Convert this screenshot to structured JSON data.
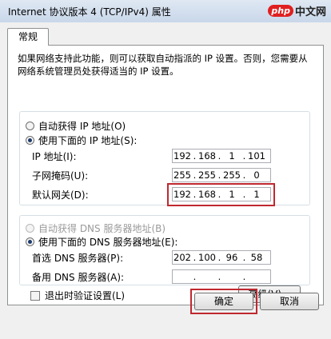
{
  "window": {
    "title": "Internet 协议版本 4 (TCP/IPv4) 属性",
    "watermark_logo": "php",
    "watermark_text": "中文网"
  },
  "tab": {
    "label": "常规"
  },
  "description": "如果网络支持此功能，则可以获取自动指派的 IP 设置。否则，您需要从网络系统管理员处获得适当的 IP 设置。",
  "ip_section": {
    "auto_label": "自动获得 IP 地址(O)",
    "manual_label": "使用下面的 IP 地址(S):",
    "selected": "manual",
    "fields": [
      {
        "label": "IP 地址(I):",
        "octets": [
          "192",
          "168",
          "1",
          "101"
        ]
      },
      {
        "label": "子网掩码(U):",
        "octets": [
          "255",
          "255",
          "255",
          "0"
        ]
      },
      {
        "label": "默认网关(D):",
        "octets": [
          "192",
          "168",
          "1",
          "1"
        ]
      }
    ]
  },
  "dns_section": {
    "auto_label": "自动获得 DNS 服务器地址(B)",
    "manual_label": "使用下面的 DNS 服务器地址(E):",
    "selected": "manual",
    "fields": [
      {
        "label": "首选 DNS 服务器(P):",
        "octets": [
          "202",
          "100",
          "96",
          "58"
        ]
      },
      {
        "label": "备用 DNS 服务器(A):",
        "octets": [
          "",
          "",
          "",
          ""
        ]
      }
    ]
  },
  "validate_on_exit": {
    "label": "退出时验证设置(L)",
    "checked": false
  },
  "buttons": {
    "advanced": "高级(V)...",
    "ok": "确定",
    "cancel": "取消"
  },
  "colors": {
    "highlight": "#c0282f",
    "titlebar": "#c9d7ea",
    "dialog_bg": "#f0f0f0"
  }
}
